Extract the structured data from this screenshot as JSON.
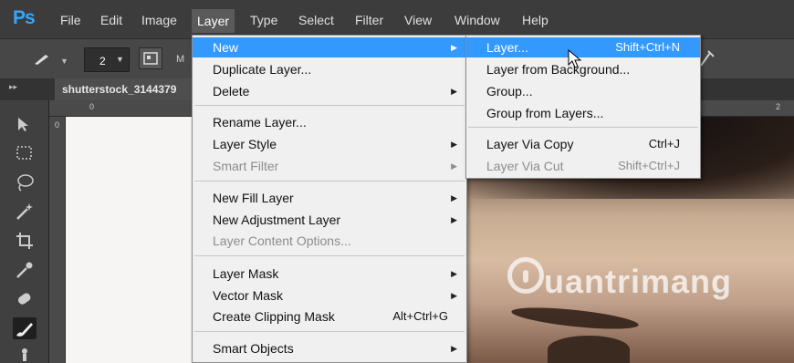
{
  "app": {
    "logo": "Ps"
  },
  "menubar": {
    "items": [
      {
        "label": "File"
      },
      {
        "label": "Edit"
      },
      {
        "label": "Image"
      },
      {
        "label": "Layer"
      },
      {
        "label": "Type"
      },
      {
        "label": "Select"
      },
      {
        "label": "Filter"
      },
      {
        "label": "View"
      },
      {
        "label": "Window"
      },
      {
        "label": "Help"
      }
    ],
    "active": "Layer"
  },
  "options": {
    "brush_size": "2",
    "mode_prefix": "M"
  },
  "document": {
    "tab_title": "shutterstock_3144379"
  },
  "rulers": {
    "top_start": "0",
    "top_end": "2",
    "left_start": "0"
  },
  "layer_menu": {
    "items": [
      {
        "label": "New",
        "submenu": true,
        "highlight": true
      },
      {
        "label": "Duplicate Layer..."
      },
      {
        "label": "Delete",
        "submenu": true
      },
      {
        "label": "Rename Layer..."
      },
      {
        "label": "Layer Style",
        "submenu": true
      },
      {
        "label": "Smart Filter",
        "submenu": true,
        "disabled": true
      },
      {
        "label": "New Fill Layer",
        "submenu": true
      },
      {
        "label": "New Adjustment Layer",
        "submenu": true
      },
      {
        "label": "Layer Content Options...",
        "disabled": true
      },
      {
        "label": "Layer Mask",
        "submenu": true
      },
      {
        "label": "Vector Mask",
        "submenu": true
      },
      {
        "label": "Create Clipping Mask",
        "shortcut": "Alt+Ctrl+G"
      },
      {
        "label": "Smart Objects",
        "submenu": true
      }
    ]
  },
  "new_submenu": {
    "items": [
      {
        "label": "Layer...",
        "shortcut": "Shift+Ctrl+N",
        "highlight": true
      },
      {
        "label": "Layer from Background..."
      },
      {
        "label": "Group..."
      },
      {
        "label": "Group from Layers..."
      },
      {
        "label": "Layer Via Copy",
        "shortcut": "Ctrl+J"
      },
      {
        "label": "Layer Via Cut",
        "shortcut": "Shift+Ctrl+J",
        "disabled": true
      }
    ]
  },
  "watermark": {
    "text": "uantrimang"
  },
  "colors": {
    "highlight": "#3399ff",
    "menu_bg": "#f0f0f0",
    "ps_blue": "#31a8ff"
  }
}
